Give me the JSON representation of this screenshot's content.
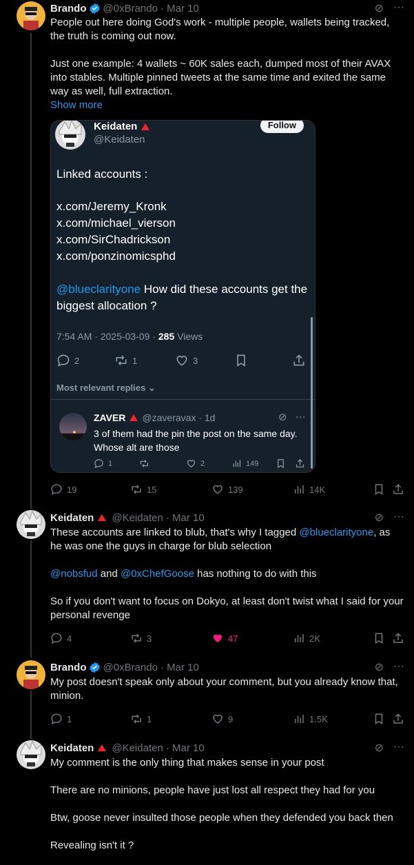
{
  "tweets": [
    {
      "name": "Brando",
      "handle": "@0xBrando",
      "date": "· Mar 10",
      "body": [
        "People out here doing God's work - multiple people, wallets being tracked, the truth is coming out now.",
        "Just one example: 4 wallets ~ 60K sales each, dumped most of their AVAX into stables. Multiple pinned tweets at the same time and exited the same way as well, full extraction."
      ],
      "show_more": "Show more",
      "replies": "19",
      "reposts": "15",
      "likes": "139",
      "views": "14K"
    },
    {
      "name": "Keidaten",
      "handle": "@Keidaten",
      "date": "· Mar 10",
      "line1_a": "These accounts are linked to blub, that's why I tagged ",
      "line1_link": "@blueclarityone",
      "line1_b": ", as he was one the guys in charge for blub selection",
      "line2_link1": "@nobsfud",
      "line2_and": " and ",
      "line2_link2": "@0xChefGoose",
      "line2_rest": " has nothing to do with this",
      "line3": "So if you don't want to focus on Dokyo, at least don't twist what I said for your personal revenge",
      "replies": "4",
      "reposts": "3",
      "likes": "47",
      "views": "2K"
    },
    {
      "name": "Brando",
      "handle": "@0xBrando",
      "date": "· Mar 10",
      "body": "My post doesn't speak only about your comment, but you already know that, minion.",
      "replies": "1",
      "reposts": "1",
      "likes": "9",
      "views": "1.5K"
    },
    {
      "name": "Keidaten",
      "handle": "@Keidaten",
      "date": "· Mar 10",
      "body": [
        "My comment is the only thing that makes sense in your post",
        "There are no minions, people have just lost all respect they had for you",
        "Btw, goose never insulted those people when they defended you back then",
        "Revealing isn't it ?"
      ]
    }
  ],
  "quote": {
    "name": "Keidaten",
    "handle": "@Keidaten",
    "follow": "Follow",
    "linked": "Linked accounts :",
    "links": [
      "x.com/Jeremy_Kronk",
      "x.com/michael_vierson",
      "x.com/SirChadrickson",
      "x.com/ponzinomicsphd"
    ],
    "mention": "@blueclarityone",
    "question": " How did these accounts get the biggest allocation ?",
    "meta_time": "7:54 AM · 2025-03-09 · ",
    "meta_views": "285",
    "meta_views_label": " Views",
    "replies": "2",
    "reposts": "1",
    "likes": "3",
    "relevant": "Most relevant replies",
    "reply": {
      "name": "ZAVER",
      "handle": "@zaveravax · 1d",
      "text": "3 of them had the pin the post on the same day. Whose alt are those",
      "replies": "1",
      "likes": "2",
      "views": "149"
    }
  },
  "colors": {
    "accent": "#1d9bf0",
    "like": "#f91880",
    "verified": "#1d9bf0",
    "red": "#f4212e"
  }
}
